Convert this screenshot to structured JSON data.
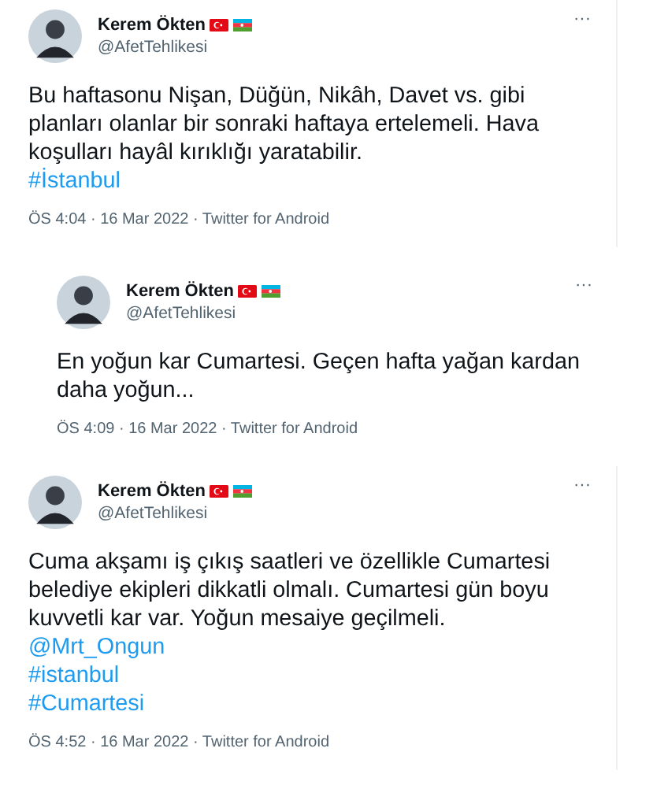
{
  "tweets": [
    {
      "name": "Kerem Ökten",
      "flags": [
        {
          "kind": "turkey"
        },
        {
          "kind": "azerbaijan"
        }
      ],
      "handle": "@AfetTehlikesi",
      "more": "···",
      "text": "Bu haftasonu Nişan, Düğün, Nikâh, Davet vs. gibi planları olanlar bir sonraki haftaya ertelemeli. Hava koşulları hayâl kırıklığı yaratabilir.",
      "links": [
        "#İstanbul"
      ],
      "meta": "ÖS 4:04 · 16 Mar 2022 · Twitter for Android"
    },
    {
      "name": "Kerem Ökten",
      "flags": [
        {
          "kind": "turkey"
        },
        {
          "kind": "azerbaijan"
        }
      ],
      "handle": "@AfetTehlikesi",
      "more": "···",
      "text": "En yoğun kar Cumartesi. Geçen hafta yağan kardan daha yoğun...",
      "meta": "ÖS 4:09 · 16 Mar 2022 · Twitter for Android"
    },
    {
      "name": "Kerem Ökten",
      "flags": [
        {
          "kind": "turkey"
        },
        {
          "kind": "azerbaijan"
        }
      ],
      "handle": "@AfetTehlikesi",
      "more": "···",
      "text": "Cuma akşamı iş çıkış saatleri ve özellikle Cumartesi belediye ekipleri dikkatli olmalı. Cumartesi gün boyu kuvvetli kar var. Yoğun mesaiye geçilmeli.",
      "links": [
        "@Mrt_Ongun",
        "#istanbul",
        "#Cumartesi"
      ],
      "meta": "ÖS 4:52 · 16 Mar 2022 · Twitter for Android"
    }
  ]
}
